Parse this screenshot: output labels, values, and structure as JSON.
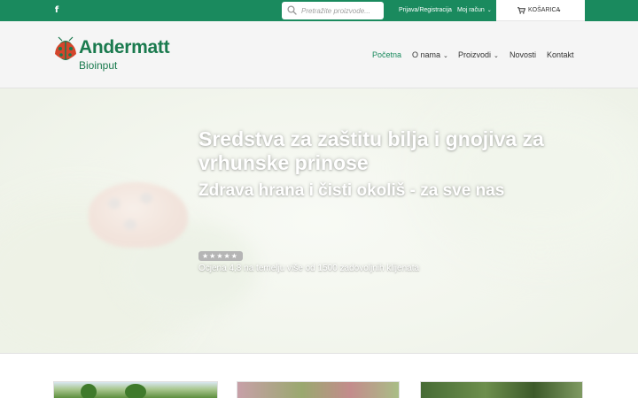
{
  "topbar": {
    "facebook_icon_label": "f",
    "search_placeholder": "Pretražite proizvode...",
    "login_label": "Prijava/Registracija",
    "account_label": "Moj račun",
    "cart_label": "KOŠARICA",
    "colors": {
      "bar": "#1a8a5e"
    }
  },
  "header": {
    "logo_name": "Andermatt",
    "logo_sub": "Bioinput",
    "nav": [
      {
        "label": "Početna",
        "active": true
      },
      {
        "label": "O nama",
        "dropdown": true
      },
      {
        "label": "Proizvodi",
        "dropdown": true
      },
      {
        "label": "Novosti"
      },
      {
        "label": "Kontakt"
      }
    ],
    "colors": {
      "accent": "#1a8a5e",
      "logo": "#1a7a4e"
    }
  },
  "hero": {
    "title": "Sredstva za zaštitu bilja i gnojiva za vrhunske prinose",
    "subtitle": "Zdrava hrana i čisti okoliš - za sve nas",
    "rating_stars": "★★★★★",
    "rating_value": 4.8,
    "rating_text": "Ocjena 4,8 na temelju više od 1500 zadovoljnih klijenata"
  },
  "icons": [
    "facebook-icon",
    "search-icon",
    "cart-icon",
    "chevron-down-icon",
    "ladybug-logo-icon",
    "star-icon"
  ]
}
